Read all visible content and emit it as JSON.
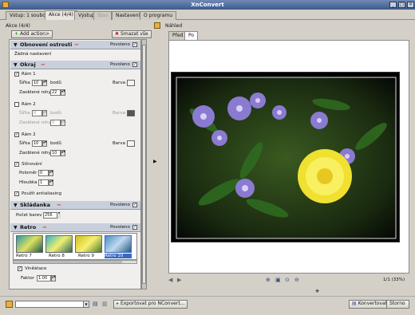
{
  "window": {
    "title": "XnConvert"
  },
  "tabs": [
    {
      "label": "Vstup: 1 soubor"
    },
    {
      "label": "Akce (4/4)"
    },
    {
      "label": "Výstup"
    },
    {
      "label": "Stav"
    },
    {
      "label": "Nastavení"
    },
    {
      "label": "O programu"
    }
  ],
  "actions": {
    "group_label": "Akce (4/4)",
    "add_button": "Add action>",
    "clear_button": "Smazat vše",
    "enabled_label": "Povoleno",
    "sharpen": {
      "title": "Obnovení ostrosti",
      "note": "Žádná nastavení"
    },
    "border": {
      "title": "Okraj",
      "frame1": {
        "label": "Rám 1",
        "width_label": "Šířka",
        "width_value": "10",
        "unit": "bodů",
        "color_label": "Barva",
        "round_label": "Zaoblené rohy",
        "round_value": "22"
      },
      "frame2": {
        "label": "Rám 2",
        "width_label": "Šířka",
        "width_value": "0",
        "unit": "bodů",
        "color_label": "Barva",
        "round_label": "Zaoblené rohy",
        "round_value": "0"
      },
      "frame3": {
        "label": "Rám 2",
        "width_label": "Šířka",
        "width_value": "10",
        "unit": "bodů",
        "color_label": "Barva",
        "round_label": "Zaoblené rohy",
        "round_value": "10"
      },
      "shadow_label": "Stínování",
      "radius_label": "Poloměr",
      "radius_value": "0",
      "depth_label": "Hloubka",
      "depth_value": "1",
      "antialias_label": "Použít antialiasing"
    },
    "stack": {
      "title": "Skládanka",
      "colors_label": "Počet barev",
      "colors_value": "256"
    },
    "retro": {
      "title": "Retro",
      "thumbs": [
        "Retro 7",
        "Retro 8",
        "Retro 9",
        "Retro 10"
      ],
      "vignette_label": "Viněátace",
      "factor_label": "Faktor",
      "factor_value": "1.00"
    }
  },
  "preview": {
    "title": "Náhled",
    "tabs": [
      "Před",
      "Po"
    ],
    "status": "1/1 (33%)"
  },
  "bottom": {
    "export_button": "Exportovat pro NConvert...",
    "convert_button": "Konvertovat",
    "close_button": "Storno"
  },
  "colors": {
    "title_bar": "#3d5a8a",
    "section_header": "#c9d0dc",
    "minus": "#c02020"
  }
}
